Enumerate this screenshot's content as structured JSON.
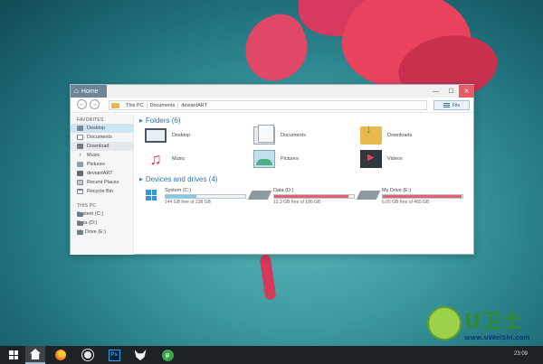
{
  "window": {
    "title": "Home",
    "minimize_glyph": "—",
    "maximize_glyph": "☐",
    "close_glyph": "✕"
  },
  "toolbar": {
    "back_glyph": "←",
    "forward_glyph": "→",
    "breadcrumbs": [
      "This PC",
      "Documents",
      "deviantART"
    ],
    "file_button_label": "File"
  },
  "sidebar": {
    "favorites_heading": "FAVORITES",
    "favorites": [
      {
        "label": "Desktop",
        "icon": "desktop-icon",
        "state": "selected"
      },
      {
        "label": "Documents",
        "icon": "documents-icon"
      },
      {
        "label": "Download",
        "icon": "download-icon",
        "state": "hover"
      },
      {
        "label": "Music",
        "icon": "music-icon"
      },
      {
        "label": "Pictures",
        "icon": "pictures-icon"
      },
      {
        "label": "deviantART",
        "icon": "folder-icon"
      },
      {
        "label": "Recent Places",
        "icon": "recent-places-icon"
      },
      {
        "label": "Recycle Bin",
        "icon": "recycle-bin-icon"
      }
    ],
    "thispc_heading": "THIS PC",
    "drives": [
      {
        "label": "System (C:)",
        "icon": "drive-icon"
      },
      {
        "label": "Data (D:)",
        "icon": "drive-icon"
      },
      {
        "label": "My Drive (E:)",
        "icon": "drive-icon"
      }
    ]
  },
  "main": {
    "folders_heading": "Folders (6)",
    "folders": [
      {
        "label": "Desktop",
        "icon": "desktop-icon"
      },
      {
        "label": "Documents",
        "icon": "documents-icon"
      },
      {
        "label": "Downloads",
        "icon": "downloads-icon"
      },
      {
        "label": "Music",
        "icon": "music-icon"
      },
      {
        "label": "Pictures",
        "icon": "pictures-icon"
      },
      {
        "label": "Videos",
        "icon": "videos-icon"
      }
    ],
    "devices_heading": "Devices and drives (4)",
    "drives": [
      {
        "name": "System (C:)",
        "free_text": "144 GB free of 238 GB",
        "used_fraction": 0.39,
        "bar_color": "#7dcbe6",
        "icon": "windows-drive-icon"
      },
      {
        "name": "Data (D:)",
        "free_text": "12,3 GB free of 186 GB",
        "used_fraction": 0.93,
        "bar_color": "#e8606f",
        "icon": "hard-drive-icon"
      },
      {
        "name": "My Drive (E:)",
        "free_text": "6,05 GB free of 465 GB",
        "used_fraction": 0.99,
        "bar_color": "#e8606f",
        "icon": "hard-drive-icon"
      }
    ]
  },
  "taskbar": {
    "clock": "23:09"
  },
  "watermark": {
    "title": "U卫士",
    "url": "www.uWeiShi.com"
  },
  "colors": {
    "accent": "#2b79b3",
    "close_button": "#e95a64",
    "selection": "#cde4f5",
    "drive_ok": "#7dcbe6",
    "drive_full": "#e8606f"
  }
}
